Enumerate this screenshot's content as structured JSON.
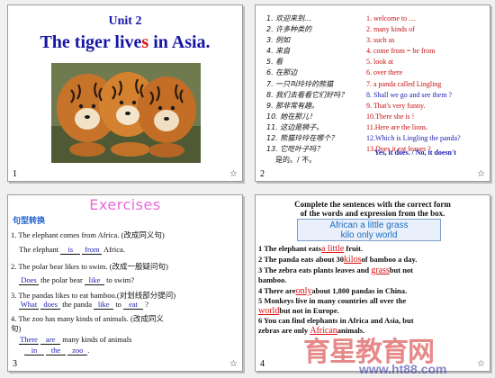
{
  "slides": [
    {
      "number": "1",
      "star": "☆",
      "unit": "Unit 2",
      "title_pre": "The tiger live",
      "title_mid": "s",
      "title_post": " in Asia."
    },
    {
      "number": "2",
      "star": "☆",
      "cn_lines": [
        "1. 欢迎来到…",
        "2. 许多种类的",
        "3. 例如",
        "4. 来自",
        "5. 看",
        "6. 在那边",
        "7. 一只叫玲玲的熊猫",
        "8. 我们去看看它们好吗？",
        "9. 那非常有趣。",
        "10. 她在那儿！",
        "11. 这边是狮子。",
        "12. 熊猫玲玲在哪个？",
        "13. 它吃叶子吗？"
      ],
      "cn_tail": "是的。/ 不。",
      "en_lines": [
        "1. welcome to …",
        "2. many kinds of",
        "3. such as",
        "4. come from = be from",
        "5. look at",
        "6. over there",
        "7. a panda called Lingling",
        "8. Shall we go and see them ?",
        "9. That's very funny.",
        "10.There she is !",
        "11.Here are the lions.",
        "12.Which is Lingling the panda?",
        "13.Does it eat leaves ?"
      ],
      "answer": "Yes, it does.  / No, it doesn't"
    },
    {
      "number": "3",
      "star": "☆",
      "heading": "Exercises",
      "subheading": "句型转换",
      "q1": "1. The elephant comes from Africa. (改成同义句)",
      "q1b_pre": "The elephant",
      "q1_a1": "is",
      "q1_a2": "from",
      "q1b_post": "Africa.",
      "q2": "2. The polar bear likes to swim. (改成一般疑问句)",
      "q2_a1": "Does",
      "q2b_mid": "the polar bear",
      "q2_a2": "like",
      "q2b_post": "to swim?",
      "q3": "3. The pandas likes to eat bamboo.(对划线部分提问)",
      "q3_a1": "What",
      "q3_a2": "does",
      "q3b_mid": "the panda",
      "q3_a3": "like",
      "q3b_to": "to",
      "q3_a4": "eat",
      "q3b_q": "?",
      "q4": "4. The zoo has many kinds of animals. (改成同义",
      "q4_b": "句)",
      "q4_a1": "There",
      "q4_a2": "are",
      "q4c_post": "many kinds of animals",
      "q4_a3": "in",
      "q4_a4": "the",
      "q4_a5": "zoo",
      "q4_dot": "."
    },
    {
      "number": "4",
      "star": "☆",
      "instr1": "Complete the sentences with the correct form",
      "instr2": "of the words and expression from the box.",
      "box1": "African   a little   grass",
      "box2": "kilo   only   world",
      "l1_pre": "1 The elephant eats",
      "l1_ans": "a little",
      "l1_post": "fruit.",
      "l2_pre": "2 The panda eats about 30",
      "l2_ans": "kilos",
      "l2_post": "of bamboo a day.",
      "l3_pre": "3 The zebra eats plants leaves and",
      "l3_ans": "grass",
      "l3_post": "but not",
      "l3b": "bamboo.",
      "l4_pre": "4 There are",
      "l4_ans": "only",
      "l4_post": "about 1,800 pandas in China.",
      "l5": "5 Monkeys live in many countries all over the",
      "l5_ans": "world",
      "l5_post": "but not in Europe.",
      "l6": "6 You can find elephants in Africa and Asia, but",
      "l6_pre": "zebras are only",
      "l6_ans": "African",
      "l6_post": "animals."
    }
  ],
  "watermark": {
    "text": "育星教育网",
    "url": "www.ht88.com"
  },
  "colors": {
    "title_blue": "#1515a5",
    "accent_red": "#d11111",
    "exercise_pink": "#e86ad8"
  }
}
